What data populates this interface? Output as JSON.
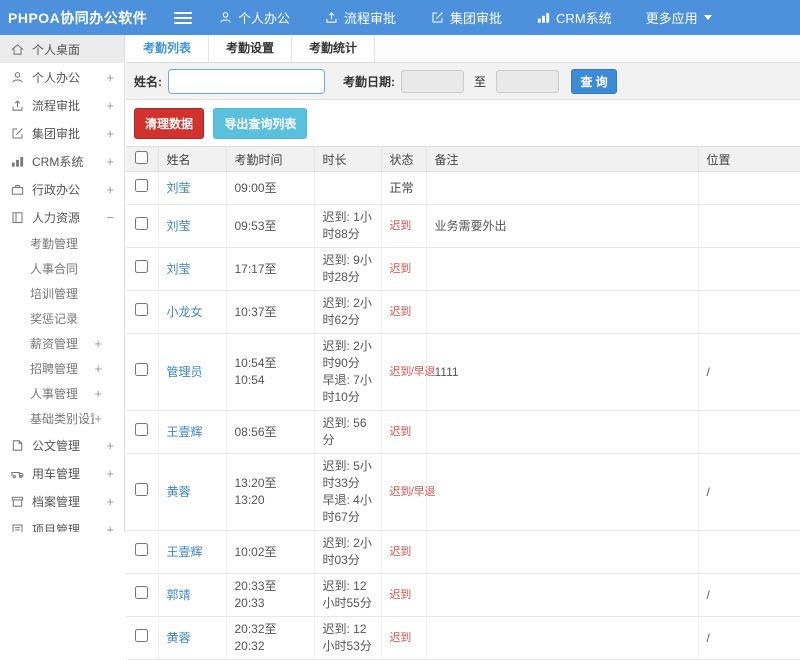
{
  "topbar": {
    "logo": "PHPOA协同办公软件",
    "nav": [
      {
        "label": "个人办公",
        "icon": "user-icon",
        "caret": false
      },
      {
        "label": "流程审批",
        "icon": "flow-icon",
        "caret": false
      },
      {
        "label": "集团审批",
        "icon": "edit-icon",
        "caret": false
      },
      {
        "label": "CRM系统",
        "icon": "chart-icon",
        "caret": false
      },
      {
        "label": "更多应用",
        "icon": "",
        "caret": true
      }
    ]
  },
  "sidebar": {
    "items": [
      {
        "label": "个人桌面",
        "icon": "home-icon",
        "type": "main",
        "active": true,
        "expand": ""
      },
      {
        "label": "个人办公",
        "icon": "user-icon",
        "type": "main",
        "active": false,
        "expand": "+"
      },
      {
        "label": "流程审批",
        "icon": "flow-icon",
        "type": "main",
        "active": false,
        "expand": "+"
      },
      {
        "label": "集团审批",
        "icon": "edit-icon",
        "type": "main",
        "active": false,
        "expand": "+"
      },
      {
        "label": "CRM系统",
        "icon": "chart-icon",
        "type": "main",
        "active": false,
        "expand": "+"
      },
      {
        "label": "行政办公",
        "icon": "briefcase-icon",
        "type": "main",
        "active": false,
        "expand": "+"
      },
      {
        "label": "人力资源",
        "icon": "hr-icon",
        "type": "main",
        "active": false,
        "expand": "−"
      },
      {
        "label": "考勤管理",
        "icon": "",
        "type": "sub",
        "active": false,
        "expand": ""
      },
      {
        "label": "人事合同",
        "icon": "",
        "type": "sub",
        "active": false,
        "expand": ""
      },
      {
        "label": "培训管理",
        "icon": "",
        "type": "sub",
        "active": false,
        "expand": ""
      },
      {
        "label": "奖惩记录",
        "icon": "",
        "type": "sub",
        "active": false,
        "expand": ""
      },
      {
        "label": "薪资管理",
        "icon": "",
        "type": "sub",
        "active": false,
        "expand": "+"
      },
      {
        "label": "招聘管理",
        "icon": "",
        "type": "sub",
        "active": false,
        "expand": "+"
      },
      {
        "label": "人事管理",
        "icon": "",
        "type": "sub",
        "active": false,
        "expand": "+"
      },
      {
        "label": "基础类别设置",
        "icon": "",
        "type": "sub",
        "active": false,
        "expand": "+"
      },
      {
        "label": "公文管理",
        "icon": "doc-icon",
        "type": "main",
        "active": false,
        "expand": "+"
      },
      {
        "label": "用车管理",
        "icon": "car-icon",
        "type": "main",
        "active": false,
        "expand": "+"
      },
      {
        "label": "档案管理",
        "icon": "archive-icon",
        "type": "main",
        "active": false,
        "expand": "+"
      },
      {
        "label": "项目管理",
        "icon": "project-icon",
        "type": "main",
        "active": false,
        "expand": "+"
      }
    ]
  },
  "tabs": [
    {
      "label": "考勤列表",
      "active": true
    },
    {
      "label": "考勤设置",
      "active": false
    },
    {
      "label": "考勤统计",
      "active": false
    }
  ],
  "filters": {
    "name_label": "姓名:",
    "name_value": "",
    "date_label": "考勤日期:",
    "date_from": "",
    "to_label": "至",
    "date_to": "",
    "search_button": "查 询"
  },
  "actions": {
    "clean_button": "清理数据",
    "export_button": "导出查询列表"
  },
  "table": {
    "columns": [
      "姓名",
      "考勤时间",
      "时长",
      "状态",
      "备注",
      "位置"
    ],
    "rows": [
      {
        "name": "刘莹",
        "time": "09:00至",
        "duration": [],
        "status": "正常",
        "status_type": "normal",
        "note": "",
        "location": ""
      },
      {
        "name": "刘莹",
        "time": "09:53至",
        "duration": [
          "迟到: 1小时88分"
        ],
        "status": "迟到",
        "status_type": "late",
        "note": "业务需要外出",
        "location": ""
      },
      {
        "name": "刘莹",
        "time": "17:17至",
        "duration": [
          "迟到: 9小时28分"
        ],
        "status": "迟到",
        "status_type": "late",
        "note": "",
        "location": ""
      },
      {
        "name": "小龙女",
        "time": "10:37至",
        "duration": [
          "迟到: 2小时62分"
        ],
        "status": "迟到",
        "status_type": "late",
        "note": "",
        "location": ""
      },
      {
        "name": "管理员",
        "time": "10:54至10:54",
        "duration": [
          "迟到: 2小时90分",
          "早退: 7小时10分"
        ],
        "status": "迟到/早退",
        "status_type": "late",
        "note": "1111",
        "location": "/"
      },
      {
        "name": "王壹辉",
        "time": "08:56至",
        "duration": [
          "迟到: 56分"
        ],
        "status": "迟到",
        "status_type": "late",
        "note": "",
        "location": ""
      },
      {
        "name": "黄蓉",
        "time": "13:20至13:20",
        "duration": [
          "迟到: 5小时33分",
          "早退: 4小时67分"
        ],
        "status": "迟到/早退",
        "status_type": "late",
        "note": "",
        "location": "/"
      },
      {
        "name": "王壹辉",
        "time": "10:02至",
        "duration": [
          "迟到: 2小时03分"
        ],
        "status": "迟到",
        "status_type": "late",
        "note": "",
        "location": ""
      },
      {
        "name": "郭靖",
        "time": "20:33至20:33",
        "duration": [
          "迟到: 12小时55分"
        ],
        "status": "迟到",
        "status_type": "late",
        "note": "",
        "location": "/"
      },
      {
        "name": "黄蓉",
        "time": "20:32至20:32",
        "duration": [
          "迟到: 12小时53分"
        ],
        "status": "迟到",
        "status_type": "late",
        "note": "",
        "location": "/"
      }
    ]
  },
  "colors": {
    "topbar": "#4d90dc",
    "tab_active": "#3f94d4",
    "link": "#3f87c0",
    "late_red": "#d9534f",
    "danger_button": "#d2322d",
    "info_button": "#5bc0de",
    "search_button": "#3d8bd4"
  }
}
